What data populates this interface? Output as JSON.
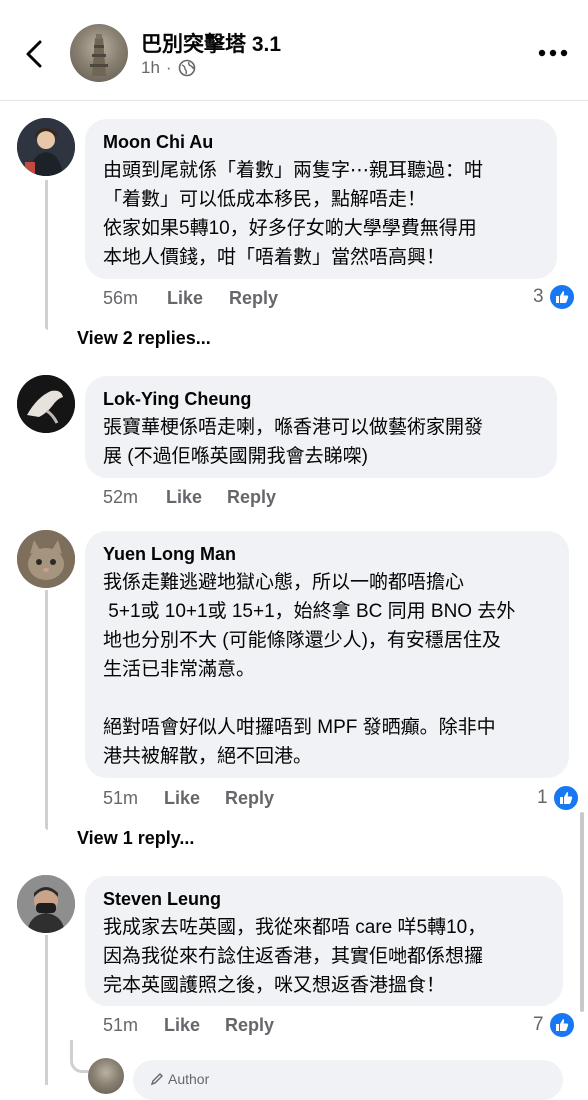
{
  "header": {
    "title": "巴別突擊塔 3.1",
    "time": "1h",
    "audience_icon": "globe-icon"
  },
  "comments": [
    {
      "author": "Moon Chi Au",
      "text": "由頭到尾就係「着數」兩隻字⋯親耳聽過：咁\n「着數」可以低成本移民，點解唔走！\n依家如果5轉10，好多仔女啲大學學費無得用\n本地人價錢，咁「唔着數」當然唔高興！",
      "time": "56m",
      "like_label": "Like",
      "reply_label": "Reply",
      "reaction_count": "3",
      "view_replies": "View 2 replies..."
    },
    {
      "author": "Lok-Ying Cheung",
      "text": "張寶華梗係唔走喇，喺香港可以做藝術家開發\n展 (不過佢喺英國開我會去睇㗎)",
      "time": "52m",
      "like_label": "Like",
      "reply_label": "Reply"
    },
    {
      "author": "Yuen Long Man",
      "text": "我係走難逃避地獄心態，所以一啲都唔擔心\n 5+1或 10+1或 15+1，始終拿 BC 同用 BNO 去外\n地也分別不大 (可能條隊還少人)，有安穩居住及\n生活已非常滿意。\n\n絕對唔會好似人咁攞唔到 MPF 發晒癲。除非中\n港共被解散，絕不回港。",
      "time": "51m",
      "like_label": "Like",
      "reply_label": "Reply",
      "reaction_count": "1",
      "view_replies": "View 1 reply..."
    },
    {
      "author": "Steven Leung",
      "text": "我成家去咗英國，我從來都唔 care 咩5轉10，\n因為我從來冇諗住返香港，其實佢哋都係想攞\n完本英國護照之後，咪又想返香港搵食！",
      "time": "51m",
      "like_label": "Like",
      "reply_label": "Reply",
      "reaction_count": "7"
    }
  ],
  "bottom_reply": {
    "label": "Author"
  }
}
